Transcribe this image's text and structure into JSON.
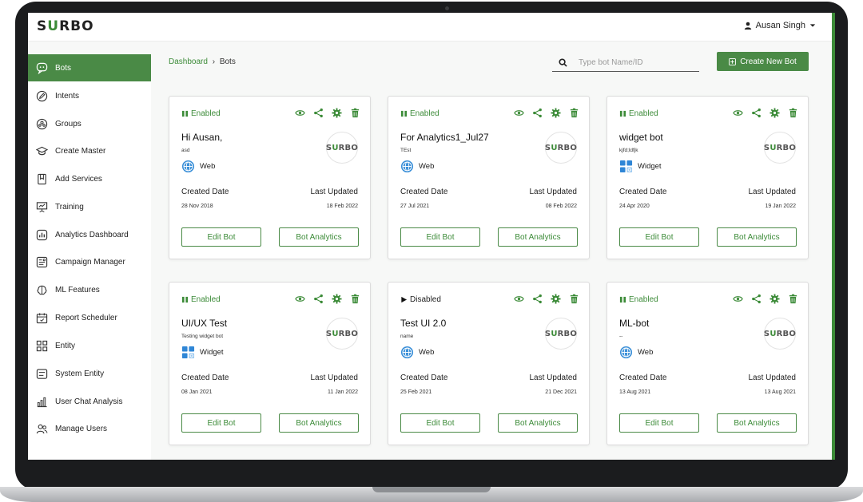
{
  "header": {
    "logo": {
      "pre": "S",
      "accent": "U",
      "post": "RBO"
    },
    "user_name": "Ausan Singh"
  },
  "colors": {
    "brand": "#4a8a46",
    "accent_text": "#3c8b38"
  },
  "sidebar": {
    "items": [
      {
        "label": "Bots",
        "icon": "chat-bot-icon",
        "active": true
      },
      {
        "label": "Intents",
        "icon": "edit-icon"
      },
      {
        "label": "Groups",
        "icon": "groups-icon"
      },
      {
        "label": "Create Master",
        "icon": "graduation-cap-icon"
      },
      {
        "label": "Add Services",
        "icon": "bookmark-icon"
      },
      {
        "label": "Training",
        "icon": "presentation-icon"
      },
      {
        "label": "Analytics Dashboard",
        "icon": "bar-chart-icon"
      },
      {
        "label": "Campaign Manager",
        "icon": "campaign-icon"
      },
      {
        "label": "ML Features",
        "icon": "brain-icon"
      },
      {
        "label": "Report Scheduler",
        "icon": "calendar-icon"
      },
      {
        "label": "Entity",
        "icon": "grid-icon"
      },
      {
        "label": "System Entity",
        "icon": "list-icon"
      },
      {
        "label": "User Chat Analysis",
        "icon": "analysis-icon"
      },
      {
        "label": "Manage Users",
        "icon": "users-icon"
      }
    ]
  },
  "breadcrumb": {
    "parent": "Dashboard",
    "separator": "›",
    "current": "Bots"
  },
  "search": {
    "placeholder": "Type bot Name/ID",
    "value": ""
  },
  "create_button": {
    "label": "Create New Bot"
  },
  "card_labels": {
    "created": "Created Date",
    "updated": "Last Updated",
    "edit": "Edit Bot",
    "analytics": "Bot Analytics"
  },
  "bots": [
    {
      "status": "Enabled",
      "name": "Hi Ausan,",
      "description": "asd",
      "channel": "Web",
      "created": "28 Nov 2018",
      "updated": "18 Feb 2022"
    },
    {
      "status": "Enabled",
      "name": "For Analytics1_Jul27",
      "description": "TEst",
      "channel": "Web",
      "created": "27 Jul 2021",
      "updated": "08 Feb 2022"
    },
    {
      "status": "Enabled",
      "name": "widget bot",
      "description": "kjfd;ldfjk",
      "channel": "Widget",
      "created": "24 Apr 2020",
      "updated": "19 Jan 2022"
    },
    {
      "status": "Enabled",
      "name": "UI/UX Test",
      "description": "Testing widget bot",
      "channel": "Widget",
      "created": "08 Jan 2021",
      "updated": "11 Jan 2022"
    },
    {
      "status": "Disabled",
      "name": "Test UI 2.0",
      "description": "name",
      "channel": "Web",
      "created": "25 Feb 2021",
      "updated": "21 Dec 2021"
    },
    {
      "status": "Enabled",
      "name": "ML-bot",
      "description": "--",
      "channel": "Web",
      "created": "13 Aug 2021",
      "updated": "13 Aug 2021"
    }
  ]
}
